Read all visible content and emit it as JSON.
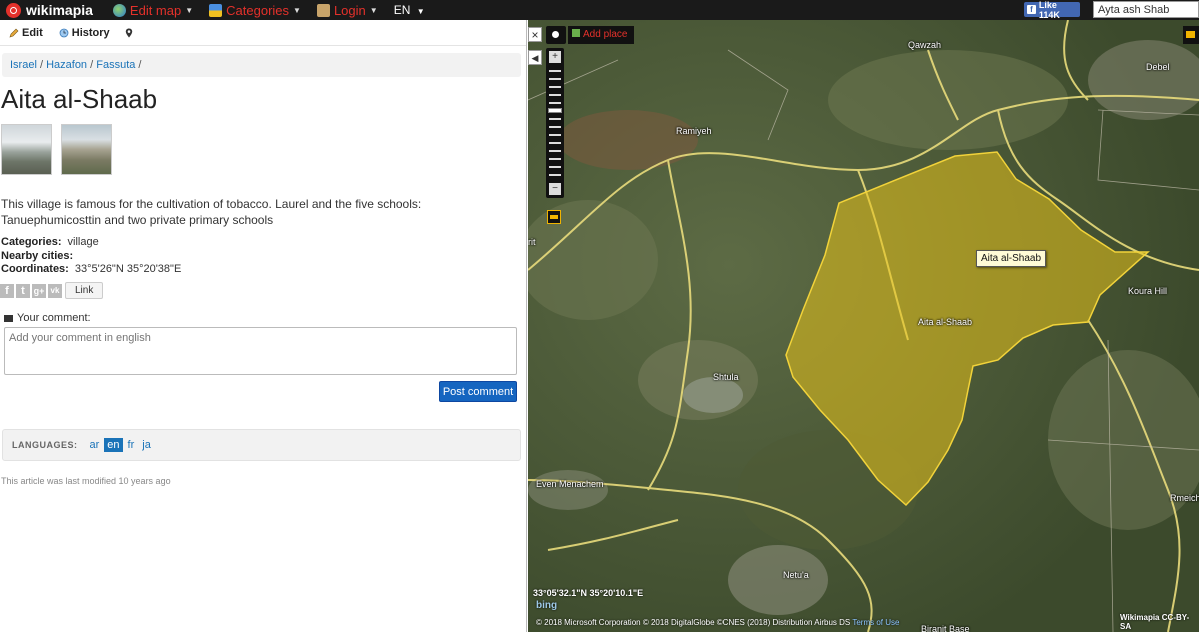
{
  "topbar": {
    "logo": "wikimapia",
    "menu": [
      {
        "label": "Edit map",
        "icon": "globe-icon",
        "color": "#e4312b"
      },
      {
        "label": "Categories",
        "icon": "categories-icon",
        "color": "#e4312b"
      },
      {
        "label": "Login",
        "icon": "login-icon",
        "color": "#e4312b"
      }
    ],
    "language": "EN",
    "fb_like": "Like 114K",
    "search_value": "Ayta ash Shab"
  },
  "toolbar": {
    "edit_label": "Edit",
    "history_label": "History"
  },
  "breadcrumb": [
    "Israel",
    "Hazafon",
    "Fassuta"
  ],
  "place": {
    "title": "Aita al-Shaab",
    "description": "This village is famous for the cultivation of tobacco. Laurel and the five schools: Tanuephumicosttin and two private primary schools",
    "categories_label": "Categories:",
    "categories_value": "village",
    "nearby_label": "Nearby cities:",
    "nearby_value": "",
    "coordinates_label": "Coordinates:",
    "coordinates_value": "33°5'26\"N 35°20'38\"E"
  },
  "share": {
    "icons": [
      "f",
      "t",
      "g+",
      "vk"
    ],
    "link_label": "Link"
  },
  "comment": {
    "label": "Your comment:",
    "placeholder": "Add your comment in english",
    "post_label": "Post comment"
  },
  "languages": {
    "label": "LANGUAGES:",
    "items": [
      {
        "code": "ar",
        "active": false
      },
      {
        "code": "en",
        "active": true
      },
      {
        "code": "fr",
        "active": false
      },
      {
        "code": "ja",
        "active": false
      }
    ]
  },
  "modified": "This article was last modified 10 years ago",
  "map": {
    "add_place": "Add place",
    "tooltip": "Aita al-Shaab",
    "labels": [
      "Qawzah",
      "Debel",
      "Ramiyeh",
      "Koura Hill",
      "Aita al-Shaab",
      "Shtula",
      "Even Menachem",
      "Netu'a",
      "Rmeich",
      "Biranit Base",
      "rit"
    ],
    "coordinates": "33°05'32.1\"N 35°20'10.1\"E",
    "bing": "bing",
    "credits": "© 2018 Microsoft Corporation © 2018 DigitalGlobe ©CNES (2018) Distribution Airbus DS",
    "terms": "Terms of Use",
    "license": "Wikimapia CC-BY-SA",
    "polygon_color": "#e8c21a"
  }
}
